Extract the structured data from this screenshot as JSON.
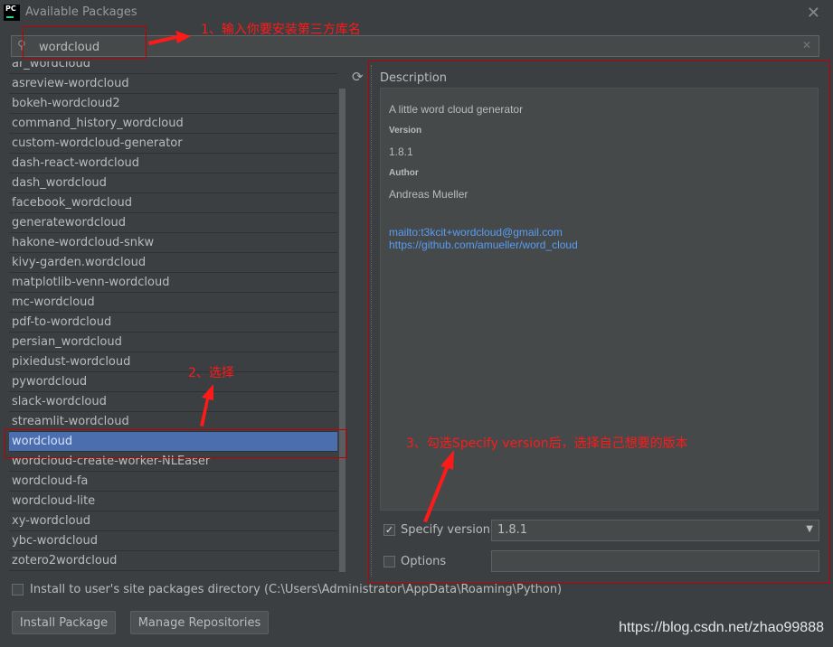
{
  "window": {
    "title": "Available Packages",
    "logo_text": "PC"
  },
  "search": {
    "value": "wordcloud"
  },
  "packages": [
    "ar_wordcloud",
    "asreview-wordcloud",
    "bokeh-wordcloud2",
    "command_history_wordcloud",
    "custom-wordcloud-generator",
    "dash-react-wordcloud",
    "dash_wordcloud",
    "facebook_wordcloud",
    "generatewordcloud",
    "hakone-wordcloud-snkw",
    "kivy-garden.wordcloud",
    "matplotlib-venn-wordcloud",
    "mc-wordcloud",
    "pdf-to-wordcloud",
    "persian_wordcloud",
    "pixiedust-wordcloud",
    "pywordcloud",
    "slack-wordcloud",
    "streamlit-wordcloud",
    "wordcloud",
    "wordcloud-create-worker-NLEaser",
    "wordcloud-fa",
    "wordcloud-lite",
    "xy-wordcloud",
    "ybc-wordcloud",
    "zotero2wordcloud"
  ],
  "selected_package": "wordcloud",
  "description": {
    "header": "Description",
    "summary": "A little word cloud generator",
    "version_label": "Version",
    "version": "1.8.1",
    "author_label": "Author",
    "author": "Andreas Mueller",
    "email_link": "mailto:t3kcit+wordcloud@gmail.com",
    "repo_link": "https://github.com/amueller/word_cloud"
  },
  "options": {
    "specify_version_label": "Specify version",
    "specify_version_checked": true,
    "version_value": "1.8.1",
    "options_label": "Options",
    "options_checked": false,
    "options_value": ""
  },
  "install_user_site_label": "Install to user's site packages directory (C:\\Users\\Administrator\\AppData\\Roaming\\Python)",
  "buttons": {
    "install": "Install Package",
    "manage": "Manage Repositories"
  },
  "annotations": {
    "step1": "1、输入你要安装第三方库名",
    "step2": "2、选择",
    "step3": "3、勾选Specify version后，选择自己想要的版本"
  },
  "watermark": "https://blog.csdn.net/zhao99888",
  "colors": {
    "background": "#3c3f41",
    "selection": "#4b6eaf",
    "link": "#589df6",
    "annotation": "#c00000"
  }
}
